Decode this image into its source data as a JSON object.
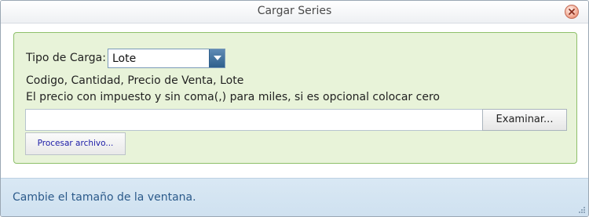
{
  "window": {
    "title": "Cargar Series"
  },
  "form": {
    "tipo_label": "Tipo de Carga:",
    "tipo_selected": "Lote",
    "info_line1": "Codigo, Cantidad, Precio de Venta, Lote",
    "info_line2": "El precio con impuesto y sin coma(,) para miles, si es opcional colocar cero",
    "file_value": "",
    "browse_label": "Examinar...",
    "process_label": "Procesar archivo..."
  },
  "status": {
    "text": "Cambie el tamaño de la ventana."
  },
  "colors": {
    "panel_bg": "#e8f3d9",
    "panel_border": "#8ec06a",
    "status_bg": "#d9e8f4",
    "status_text": "#2b5a8a",
    "process_text": "#1a1aa6"
  },
  "icons": {
    "close": "close-icon",
    "dropdown": "chevron-down-icon",
    "resize": "resize-grip-icon"
  }
}
